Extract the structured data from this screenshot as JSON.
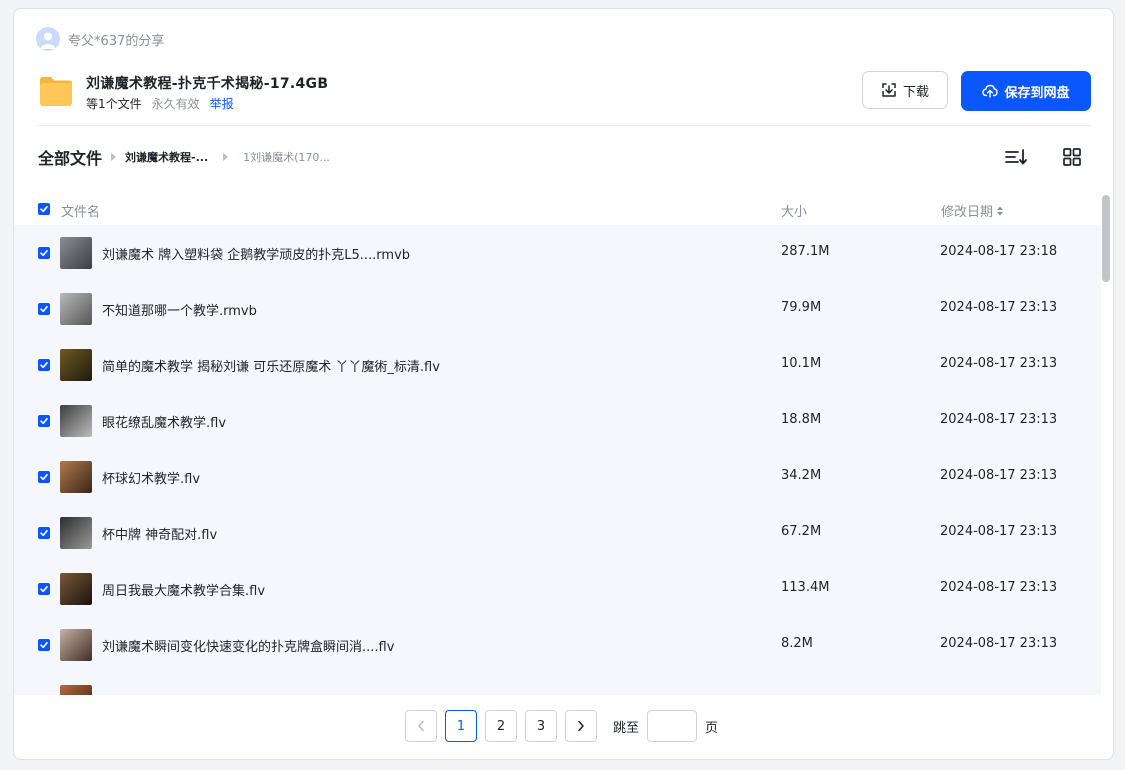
{
  "share": {
    "sharer_text": "夸父*637的分享",
    "title": "刘谦魔术教程-扑克千术揭秘-17.4GB",
    "file_count": "等1个文件",
    "validity": "永久有效",
    "report_label": "举报"
  },
  "actions": {
    "download_label": "下载",
    "save_label": "保存到网盘"
  },
  "breadcrumb": {
    "root": "全部文件",
    "items": [
      "刘谦魔术教程-...",
      "1刘谦魔术(170..."
    ]
  },
  "table": {
    "columns": {
      "name": "文件名",
      "size": "大小",
      "date": "修改日期"
    },
    "rows": [
      {
        "name": "刘谦魔术 牌入塑料袋 企鹅教学顽皮的扑克L5....rmvb",
        "size": "287.1M",
        "date": "2024-08-17 23:18",
        "checked": true
      },
      {
        "name": "不知道那哪一个教学.rmvb",
        "size": "79.9M",
        "date": "2024-08-17 23:13",
        "checked": true
      },
      {
        "name": "简单的魔术教学 揭秘刘谦 可乐还原魔术 丫丫魔術_标清.flv",
        "size": "10.1M",
        "date": "2024-08-17 23:13",
        "checked": true
      },
      {
        "name": "眼花缭乱魔术教学.flv",
        "size": "18.8M",
        "date": "2024-08-17 23:13",
        "checked": true
      },
      {
        "name": "杯球幻术教学.flv",
        "size": "34.2M",
        "date": "2024-08-17 23:13",
        "checked": true
      },
      {
        "name": "杯中牌 神奇配对.flv",
        "size": "67.2M",
        "date": "2024-08-17 23:13",
        "checked": true
      },
      {
        "name": "周日我最大魔术教学合集.flv",
        "size": "113.4M",
        "date": "2024-08-17 23:13",
        "checked": true
      },
      {
        "name": "刘谦魔术瞬间变化快速变化的扑克牌盒瞬间消....flv",
        "size": "8.2M",
        "date": "2024-08-17 23:13",
        "checked": true
      },
      {
        "name": "",
        "size": "",
        "date": "",
        "checked": false
      }
    ]
  },
  "pagination": {
    "pages": [
      "1",
      "2",
      "3"
    ],
    "current": "1",
    "jump_label": "跳至",
    "page_unit": "页"
  },
  "colors": {
    "accent": "#0b57ff",
    "row_bg": "#f5f7fc",
    "folder": "#ffc757"
  },
  "thumb_colors": [
    [
      "#8b8d93",
      "#3b3e47"
    ],
    [
      "#b9b9b9",
      "#555555"
    ],
    [
      "#6e5a22",
      "#1d1a10"
    ],
    [
      "#3d3d3d",
      "#bdbdbd"
    ],
    [
      "#b07b4e",
      "#3b2516"
    ],
    [
      "#2d2d2d",
      "#9a9a9a"
    ],
    [
      "#7a5a3a",
      "#1a120c"
    ],
    [
      "#c7b3a3",
      "#3f2e28"
    ],
    [
      "#b56a3b",
      "#3a2013"
    ]
  ]
}
